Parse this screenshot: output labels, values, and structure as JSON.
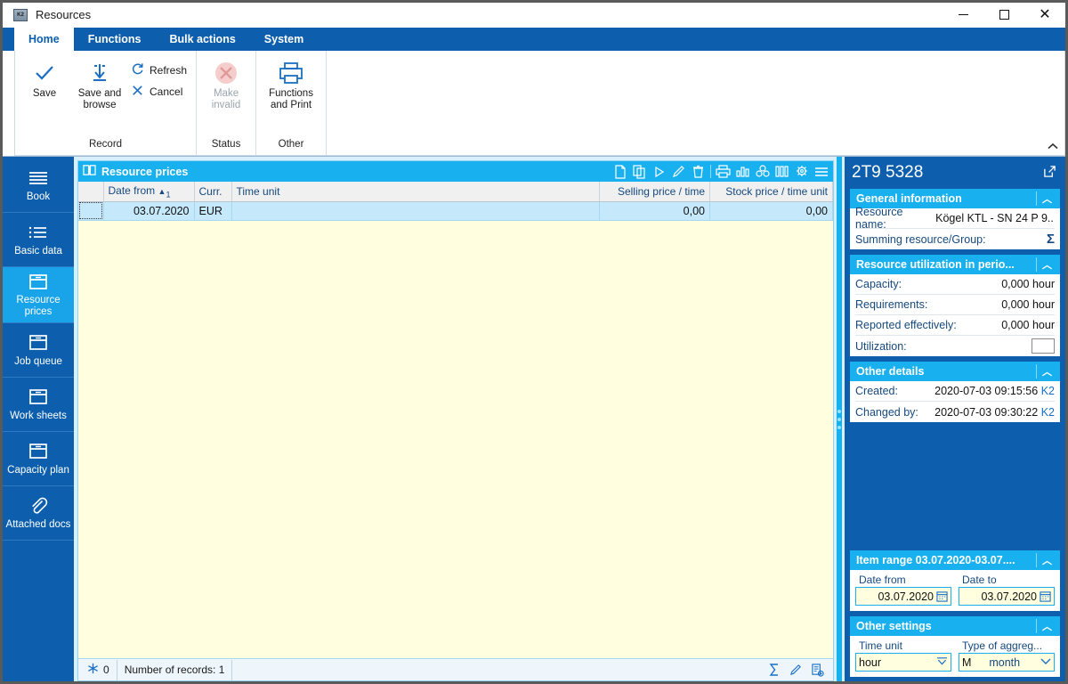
{
  "window": {
    "title": "Resources",
    "app_icon": "k2-app-icon",
    "minimize_label": "Minimize",
    "maximize_label": "Maximize",
    "close_label": "Close"
  },
  "ribbon": {
    "tabs": [
      {
        "label": "Home",
        "active": true
      },
      {
        "label": "Functions",
        "active": false
      },
      {
        "label": "Bulk actions",
        "active": false
      },
      {
        "label": "System",
        "active": false
      }
    ],
    "groups": [
      {
        "label": "Record",
        "buttons": [
          {
            "label": "Save",
            "icon": "check-icon",
            "disabled": false
          },
          {
            "label": "Save and browse",
            "icon": "save-browse-icon",
            "disabled": false
          }
        ],
        "small_buttons": [
          {
            "label": "Refresh",
            "icon": "refresh-icon"
          },
          {
            "label": "Cancel",
            "icon": "cancel-icon"
          }
        ]
      },
      {
        "label": "Status",
        "buttons": [
          {
            "label": "Make invalid",
            "icon": "make-invalid-icon",
            "disabled": true
          }
        ],
        "small_buttons": []
      },
      {
        "label": "Other",
        "buttons": [
          {
            "label": "Functions and Print",
            "icon": "printer-icon",
            "disabled": false
          }
        ],
        "small_buttons": []
      }
    ],
    "collapse_label": "Collapse the Ribbon"
  },
  "sidebar": {
    "items": [
      {
        "label": "Book",
        "icon": "book-lines-icon",
        "active": false
      },
      {
        "label": "Basic data",
        "icon": "list-icon",
        "active": false
      },
      {
        "label": "Resource prices",
        "icon": "box-icon",
        "active": true
      },
      {
        "label": "Job queue",
        "icon": "box-icon",
        "active": false
      },
      {
        "label": "Work sheets",
        "icon": "box-icon",
        "active": false
      },
      {
        "label": "Capacity plan",
        "icon": "box-icon",
        "active": false
      },
      {
        "label": "Attached docs",
        "icon": "paperclip-icon",
        "active": false
      }
    ]
  },
  "grid": {
    "title": "Resource prices",
    "title_icon": "book-icon",
    "tools": [
      {
        "name": "new-record-icon",
        "label": "New"
      },
      {
        "name": "copy-record-icon",
        "label": "Copy"
      },
      {
        "name": "run-icon",
        "label": "Run"
      },
      {
        "name": "edit-icon",
        "label": "Edit"
      },
      {
        "name": "delete-icon",
        "label": "Delete"
      },
      {
        "name": "print-icon",
        "label": "Print"
      },
      {
        "name": "chart-icon",
        "label": "Chart"
      },
      {
        "name": "group-icon",
        "label": "Grouping"
      },
      {
        "name": "columns-icon",
        "label": "Columns"
      },
      {
        "name": "settings-icon",
        "label": "Settings"
      },
      {
        "name": "menu-icon",
        "label": "Menu"
      }
    ],
    "columns": [
      {
        "label": "Date from",
        "align": "left",
        "sorted": true,
        "sort_dir": "asc",
        "sort_index": "1"
      },
      {
        "label": "Curr.",
        "align": "left"
      },
      {
        "label": "Time unit",
        "align": "left"
      },
      {
        "label": "Selling price / time",
        "align": "right"
      },
      {
        "label": "Stock price / time unit",
        "align": "right"
      }
    ],
    "rows": [
      {
        "date_from": "03.07.2020",
        "currency": "EUR",
        "time_unit": "",
        "selling_price": "0,00",
        "stock_price": "0,00"
      }
    ]
  },
  "status": {
    "filter_icon": "filter-icon",
    "filter_count": "0",
    "records_text": "Number of records: 1",
    "tools": [
      {
        "name": "sum-icon",
        "label": "Sum"
      },
      {
        "name": "edit-icon",
        "label": "Edit"
      },
      {
        "name": "new-document-icon",
        "label": "New document"
      }
    ]
  },
  "right_panel": {
    "title": "2T9 5328",
    "popout_icon": "popout-icon",
    "sections": [
      {
        "name": "general-information",
        "title": "General information",
        "collapse_icon": "chevron-up-icon",
        "rows": [
          {
            "label": "Resource name:",
            "value": "Kögel KTL - SN 24 P 9...",
            "type": "text"
          },
          {
            "label": "Summing resource/Group:",
            "value": "Σ",
            "type": "sigma"
          }
        ]
      },
      {
        "name": "resource-utilization",
        "title": "Resource utilization in perio...",
        "collapse_icon": "chevron-up-icon",
        "rows": [
          {
            "label": "Capacity:",
            "value": "0,000 hour",
            "type": "text"
          },
          {
            "label": "Requirements:",
            "value": "0,000 hour",
            "type": "text"
          },
          {
            "label": "Reported effectively:",
            "value": "0,000 hour",
            "type": "text"
          },
          {
            "label": "Utilization:",
            "value": "",
            "type": "box"
          }
        ]
      },
      {
        "name": "other-details",
        "title": "Other details",
        "collapse_icon": "chevron-up-icon",
        "rows": [
          {
            "label": "Created:",
            "value": "2020-07-03 09:15:56",
            "suffix": "K2",
            "type": "stamp"
          },
          {
            "label": "Changed by:",
            "value": "2020-07-03 09:30:22",
            "suffix": "K2",
            "type": "stamp"
          }
        ]
      }
    ],
    "item_range": {
      "name": "item-range",
      "title": "Item range 03.07.2020-03.07....",
      "collapse_icon": "chevron-up-icon",
      "date_from_label": "Date from",
      "date_from_value": "03.07.2020",
      "date_to_label": "Date to",
      "date_to_value": "03.07.2020",
      "calendar_icon": "calendar-icon"
    },
    "other_settings": {
      "name": "other-settings",
      "title": "Other settings",
      "collapse_icon": "chevron-up-icon",
      "time_unit_label": "Time unit",
      "time_unit_value": "hour",
      "aggregation_label": "Type of aggreg...",
      "aggregation_code": "M",
      "aggregation_value": "month"
    }
  },
  "colors": {
    "brand_blue": "#0d5fad",
    "accent_cyan": "#19b0ef",
    "selected_item": "#19a3e8",
    "grid_body": "#ffffe0",
    "row_selected": "#c5e9fb",
    "field_bg": "#ffffe0"
  }
}
